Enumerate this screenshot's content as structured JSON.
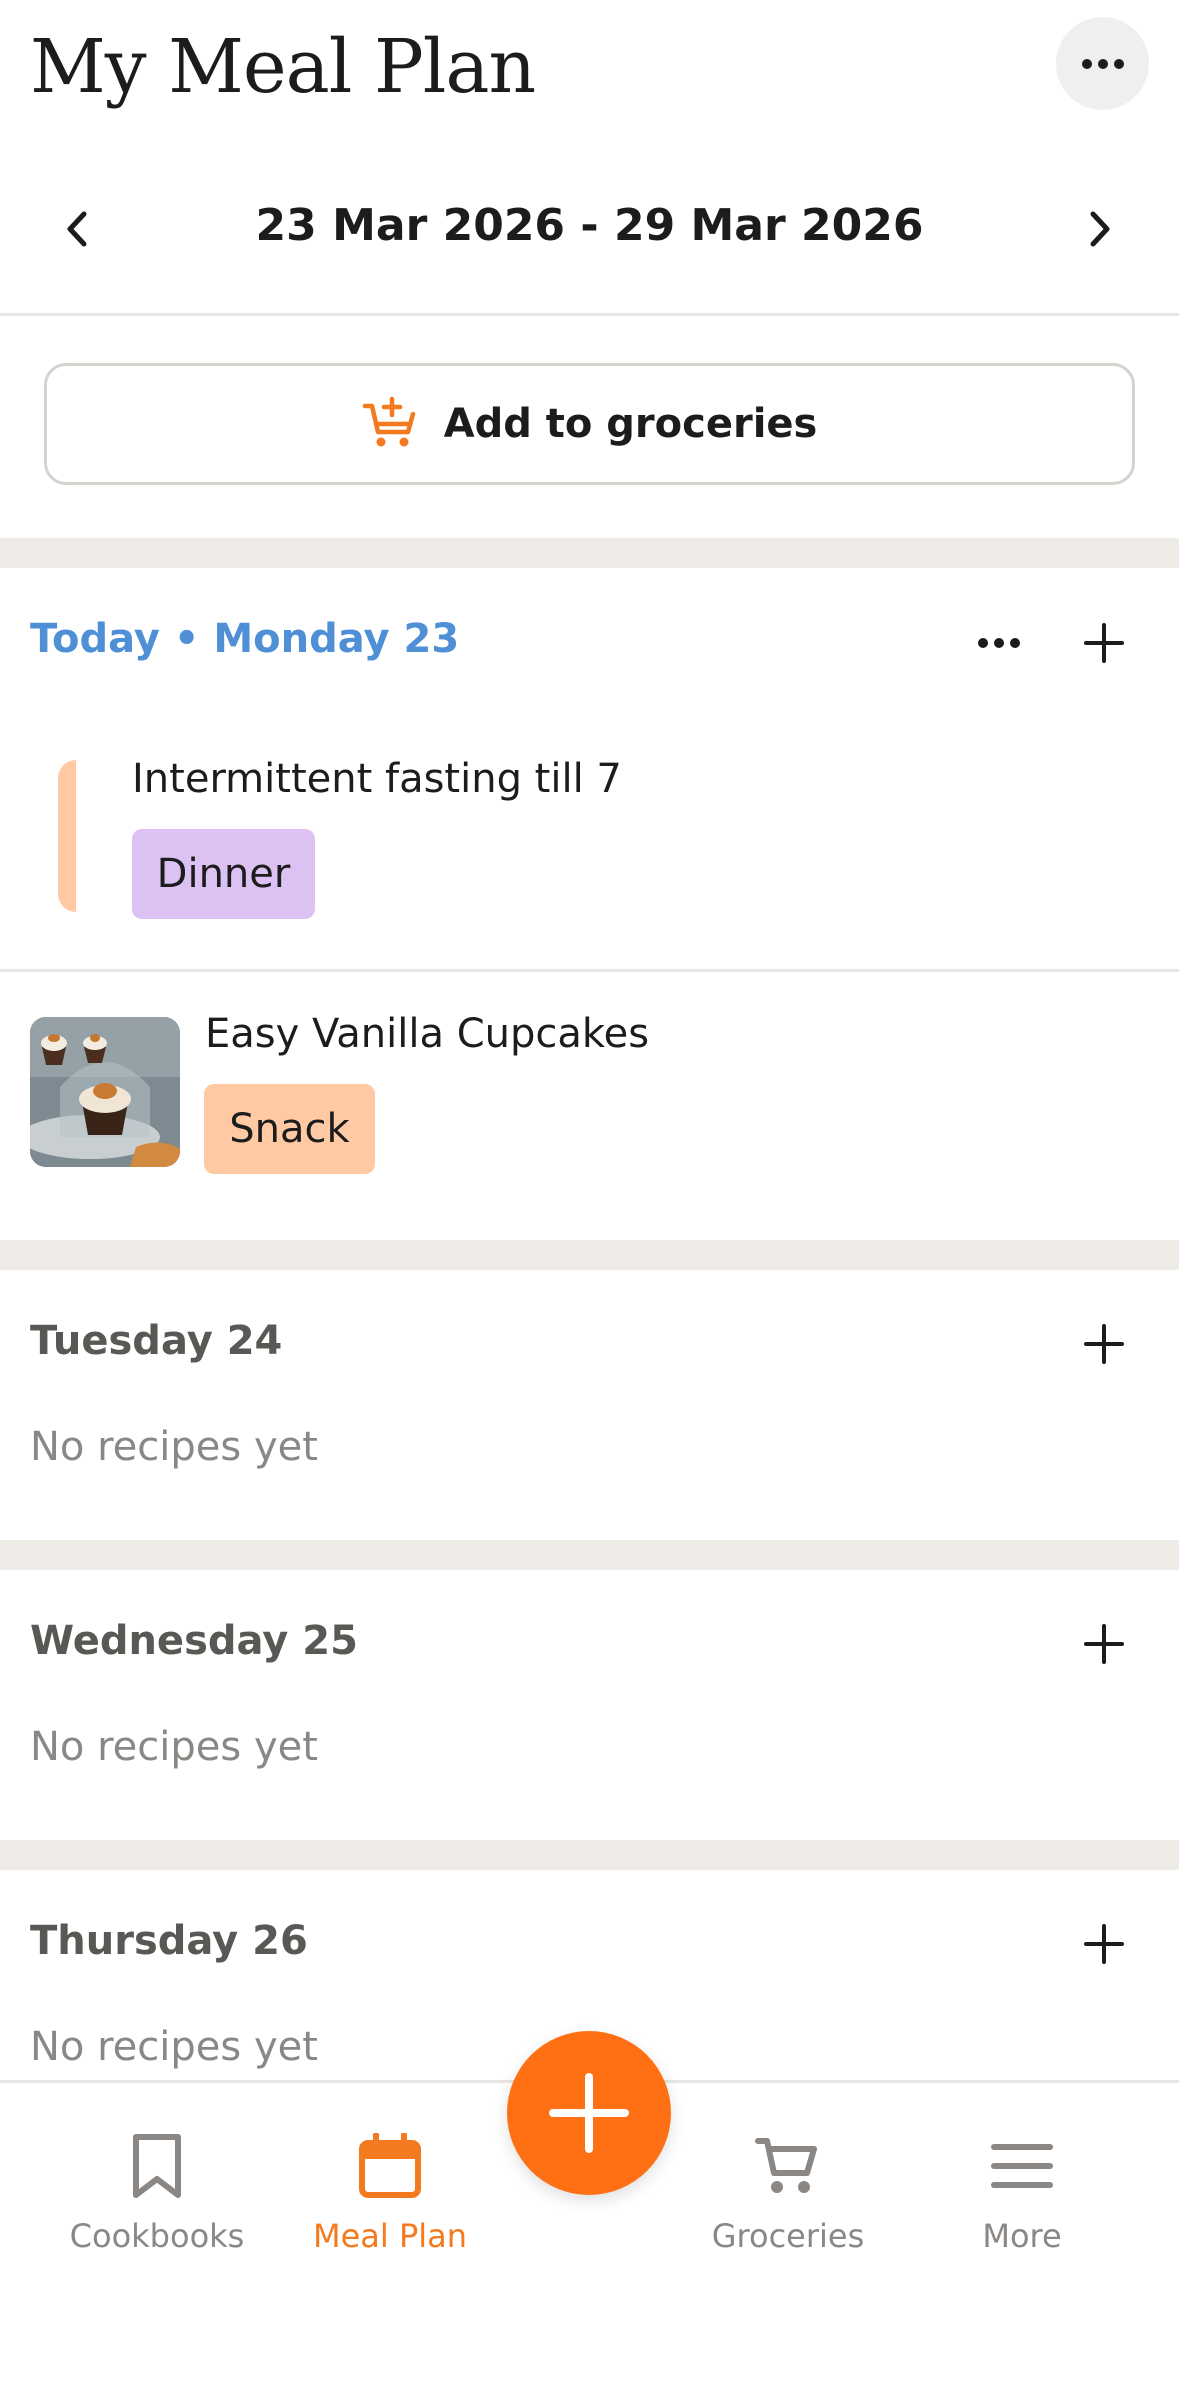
{
  "header": {
    "title": "My Meal Plan",
    "menu_icon": "more-horizontal-icon"
  },
  "week_nav": {
    "range": "23 Mar 2026 - 29 Mar 2026",
    "prev_icon": "chevron-left-icon",
    "next_icon": "chevron-right-icon"
  },
  "groceries_button": {
    "label": "Add to groceries",
    "icon": "cart-plus-icon",
    "icon_color": "#f47a20"
  },
  "days": [
    {
      "title": "Today • Monday 23",
      "is_today": true,
      "items": [
        {
          "title": "Intermittent fasting till 7",
          "tag": "Dinner",
          "tag_color": "#dcc2f3",
          "type": "note",
          "accent_color": "#ffc9a3"
        },
        {
          "title": "Easy Vanilla Cupcakes",
          "tag": "Snack",
          "tag_color": "#ffc9a3",
          "type": "recipe",
          "image": "cupcakes-photo"
        }
      ]
    },
    {
      "title": "Tuesday 24",
      "empty_text": "No recipes yet"
    },
    {
      "title": "Wednesday 25",
      "empty_text": "No recipes yet"
    },
    {
      "title": "Thursday 26",
      "empty_text": "No recipes yet"
    }
  ],
  "tabbar": {
    "tabs": [
      {
        "label": "Cookbooks",
        "icon": "bookmark-icon",
        "active": false
      },
      {
        "label": "Meal Plan",
        "icon": "calendar-icon",
        "active": true
      },
      {
        "label": "Groceries",
        "icon": "cart-icon",
        "active": false
      },
      {
        "label": "More",
        "icon": "menu-icon",
        "active": false
      }
    ],
    "fab_icon": "plus-icon"
  },
  "colors": {
    "accent": "#ff6f13",
    "today": "#4f8fd6",
    "band": "#efece8",
    "muted": "#8a8784"
  }
}
